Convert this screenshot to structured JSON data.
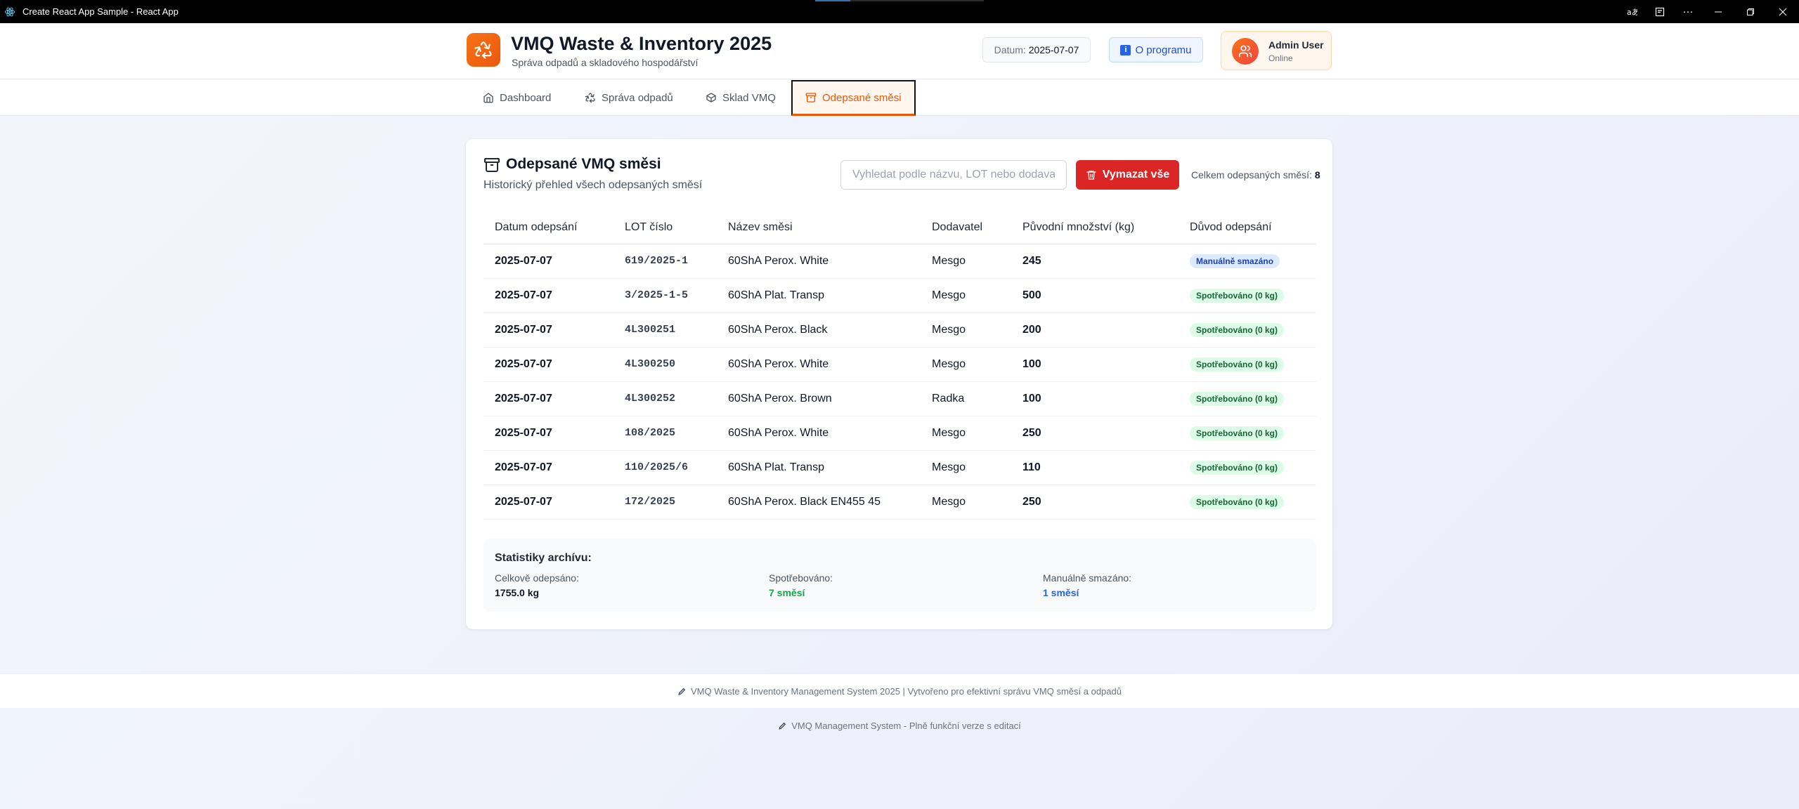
{
  "window": {
    "title": "Create React App Sample - React App"
  },
  "header": {
    "title": "VMQ Waste & Inventory 2025",
    "subtitle": "Správa odpadů a skladového hospodářství",
    "date_label": "Datum:",
    "date_value": "2025-07-07",
    "about_label": "O programu",
    "user_name": "Admin User",
    "user_status": "Online"
  },
  "nav": {
    "tabs": [
      {
        "label": "Dashboard",
        "icon": "home-icon"
      },
      {
        "label": "Správa odpadů",
        "icon": "recycle-icon"
      },
      {
        "label": "Sklad VMQ",
        "icon": "package-icon"
      },
      {
        "label": "Odepsané směsi",
        "icon": "archive-icon",
        "active": true
      }
    ]
  },
  "archive": {
    "title": "Odepsané VMQ směsi",
    "subtitle": "Historický přehled všech odepsaných směsí",
    "search_placeholder": "Vyhledat podle názvu, LOT nebo dodavatele...",
    "clear_label": "Vymazat vše",
    "total_label": "Celkem odepsaných směsí:",
    "total_value": "8",
    "columns": [
      "Datum odepsání",
      "LOT číslo",
      "Název směsi",
      "Dodavatel",
      "Původní množství (kg)",
      "Důvod odepsání"
    ],
    "rows": [
      {
        "date": "2025-07-07",
        "lot": "619/2025-1",
        "name": "60ShA Perox. White",
        "supplier": "Mesgo",
        "qty": "245",
        "reason": "Manuálně smazáno",
        "reason_type": "blue"
      },
      {
        "date": "2025-07-07",
        "lot": "3/2025-1-5",
        "name": "60ShA Plat. Transp",
        "supplier": "Mesgo",
        "qty": "500",
        "reason": "Spotřebováno (0 kg)",
        "reason_type": "green"
      },
      {
        "date": "2025-07-07",
        "lot": "4L300251",
        "name": "60ShA Perox. Black",
        "supplier": "Mesgo",
        "qty": "200",
        "reason": "Spotřebováno (0 kg)",
        "reason_type": "green"
      },
      {
        "date": "2025-07-07",
        "lot": "4L300250",
        "name": "60ShA Perox. White",
        "supplier": "Mesgo",
        "qty": "100",
        "reason": "Spotřebováno (0 kg)",
        "reason_type": "green"
      },
      {
        "date": "2025-07-07",
        "lot": "4L300252",
        "name": "60ShA Perox. Brown",
        "supplier": "Radka",
        "qty": "100",
        "reason": "Spotřebováno (0 kg)",
        "reason_type": "green"
      },
      {
        "date": "2025-07-07",
        "lot": "108/2025",
        "name": "60ShA Perox. White",
        "supplier": "Mesgo",
        "qty": "250",
        "reason": "Spotřebováno (0 kg)",
        "reason_type": "green"
      },
      {
        "date": "2025-07-07",
        "lot": "110/2025/6",
        "name": "60ShA Plat. Transp",
        "supplier": "Mesgo",
        "qty": "110",
        "reason": "Spotřebováno (0 kg)",
        "reason_type": "green"
      },
      {
        "date": "2025-07-07",
        "lot": "172/2025",
        "name": "60ShA Perox. Black EN455 45",
        "supplier": "Mesgo",
        "qty": "250",
        "reason": "Spotřebováno (0 kg)",
        "reason_type": "green"
      }
    ],
    "stats": {
      "title": "Statistiky archívu:",
      "total_label": "Celkově odepsáno:",
      "total_value": "1755.0 kg",
      "consumed_label": "Spotřebováno:",
      "consumed_value": "7 směsí",
      "manual_label": "Manuálně smazáno:",
      "manual_value": "1 směsí"
    }
  },
  "footer": {
    "main": "VMQ Waste & Inventory Management System 2025 | Vytvořeno pro efektivní správu VMQ směsí a odpadů",
    "secondary": "VMQ Management System - Plně funkční verze s editací"
  },
  "colors": {
    "accent": "#ea580c",
    "danger": "#dc2626",
    "info": "#2563eb",
    "success": "#166534"
  }
}
